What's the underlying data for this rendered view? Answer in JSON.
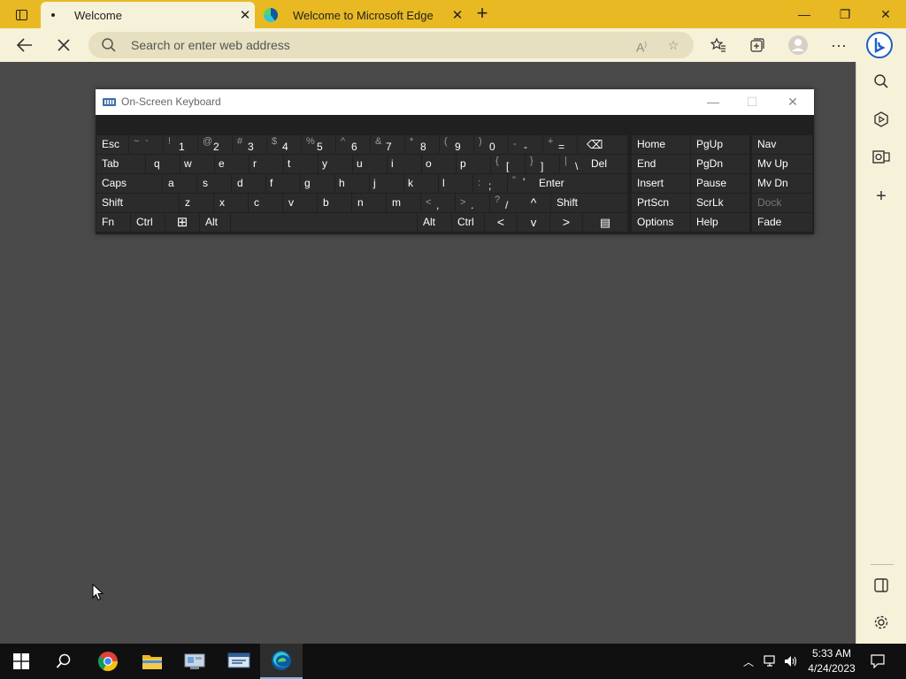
{
  "browser": {
    "tabs": [
      {
        "label": "Welcome",
        "active": true
      },
      {
        "label": "Welcome to Microsoft Edge",
        "active": false
      }
    ],
    "address": {
      "placeholder": "Search or enter web address",
      "value": ""
    },
    "colors": {
      "titlebar": "#e8b923",
      "toolbar": "#f6f1d9",
      "content": "#4a4a4a"
    }
  },
  "icons": {
    "tab_actions": "tab-actions-icon",
    "new_tab": "plus-icon",
    "minimize": "minimize-icon",
    "restore": "restore-icon",
    "close": "close-icon",
    "back": "back-arrow-icon",
    "stop": "stop-icon",
    "search": "search-icon",
    "read_aloud": "read-aloud-icon",
    "add_favorite": "star-plus-icon",
    "favorites": "favorites-icon",
    "collections": "collections-icon",
    "profile": "profile-icon",
    "more": "ellipsis-icon",
    "bing": "bing-icon"
  },
  "sidebar": {
    "items": [
      "search-icon",
      "shopping-icon",
      "outlook-icon",
      "add-icon",
      "split-view-icon",
      "settings-icon"
    ]
  },
  "osk": {
    "title": "On-Screen Keyboard",
    "rows": [
      [
        {
          "main": "Esc"
        },
        {
          "shift": "~",
          "main": "`"
        },
        {
          "shift": "!",
          "main": "1"
        },
        {
          "shift": "@",
          "main": "2"
        },
        {
          "shift": "#",
          "main": "3"
        },
        {
          "shift": "$",
          "main": "4"
        },
        {
          "shift": "%",
          "main": "5"
        },
        {
          "shift": "^",
          "main": "6"
        },
        {
          "shift": "&",
          "main": "7"
        },
        {
          "shift": "*",
          "main": "8"
        },
        {
          "shift": "(",
          "main": "9"
        },
        {
          "shift": ")",
          "main": "0"
        },
        {
          "shift": "-",
          "main": "-"
        },
        {
          "shift": "+",
          "main": "="
        },
        {
          "main": "⌫"
        },
        {
          "main": "Home"
        },
        {
          "main": "PgUp"
        },
        {
          "main": "Nav"
        }
      ],
      [
        {
          "main": "Tab"
        },
        {
          "main": "q"
        },
        {
          "main": "w"
        },
        {
          "main": "e"
        },
        {
          "main": "r"
        },
        {
          "main": "t"
        },
        {
          "main": "y"
        },
        {
          "main": "u"
        },
        {
          "main": "i"
        },
        {
          "main": "o"
        },
        {
          "main": "p"
        },
        {
          "shift": "{",
          "main": "["
        },
        {
          "shift": "}",
          "main": "]"
        },
        {
          "shift": "|",
          "main": "\\"
        },
        {
          "main": "Del"
        },
        {
          "main": "End"
        },
        {
          "main": "PgDn"
        },
        {
          "main": "Mv Up"
        }
      ],
      [
        {
          "main": "Caps"
        },
        {
          "main": "a"
        },
        {
          "main": "s"
        },
        {
          "main": "d"
        },
        {
          "main": "f"
        },
        {
          "main": "g"
        },
        {
          "main": "h"
        },
        {
          "main": "j"
        },
        {
          "main": "k"
        },
        {
          "main": "l"
        },
        {
          "shift": ":",
          "main": ";"
        },
        {
          "shift": "\"",
          "main": "'"
        },
        {
          "main": "Enter"
        },
        {
          "main": "Insert"
        },
        {
          "main": "Pause"
        },
        {
          "main": "Mv Dn"
        }
      ],
      [
        {
          "main": "Shift"
        },
        {
          "main": "z"
        },
        {
          "main": "x"
        },
        {
          "main": "c"
        },
        {
          "main": "v"
        },
        {
          "main": "b"
        },
        {
          "main": "n"
        },
        {
          "main": "m"
        },
        {
          "shift": "<",
          "main": ","
        },
        {
          "shift": ">",
          "main": "."
        },
        {
          "shift": "?",
          "main": "/"
        },
        {
          "main": "^"
        },
        {
          "main": "Shift"
        },
        {
          "main": "PrtScn"
        },
        {
          "main": "ScrLk"
        },
        {
          "main": "Dock"
        }
      ],
      [
        {
          "main": "Fn"
        },
        {
          "main": "Ctrl"
        },
        {
          "main": "⊞"
        },
        {
          "main": "Alt"
        },
        {
          "main": ""
        },
        {
          "main": "Alt"
        },
        {
          "main": "Ctrl"
        },
        {
          "main": "<"
        },
        {
          "main": "v"
        },
        {
          "main": ">"
        },
        {
          "main": "▤"
        },
        {
          "main": "Options"
        },
        {
          "main": "Help"
        },
        {
          "main": "Fade"
        }
      ]
    ]
  },
  "taskbar": {
    "apps": [
      "windows-start-icon",
      "search-icon",
      "chrome-icon",
      "file-explorer-icon",
      "control-panel-icon",
      "remote-desktop-icon",
      "edge-icon"
    ],
    "time": "5:33 AM",
    "date": "4/24/2023"
  }
}
